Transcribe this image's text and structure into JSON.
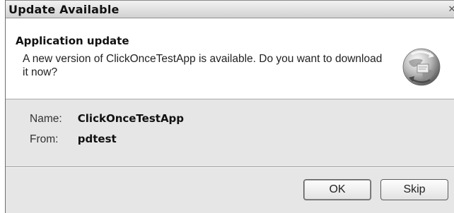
{
  "window": {
    "title": "Update Available",
    "close_glyph": "✕"
  },
  "header": {
    "title": "Application update",
    "message": "A new version of ClickOnceTestApp is available. Do you want to download it now?",
    "icon": "globe-update-icon"
  },
  "details": {
    "name_label": "Name:",
    "name_value": "ClickOnceTestApp",
    "from_label": "From:",
    "from_value": "pdtest"
  },
  "buttons": {
    "ok_label": "OK",
    "skip_label": "Skip"
  }
}
